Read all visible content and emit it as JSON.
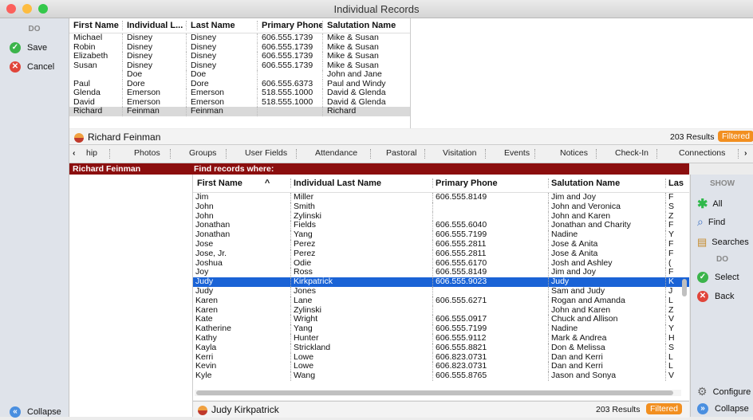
{
  "window": {
    "title": "Individual Records"
  },
  "left_sidebar": {
    "do_label": "DO",
    "save_label": "Save",
    "cancel_label": "Cancel",
    "collapse_label": "Collapse"
  },
  "top_table": {
    "columns": [
      "First Name",
      "Individual L...",
      "^",
      "Last Name",
      "Primary Phone",
      "Salutation Name"
    ],
    "rows": [
      [
        "Michael",
        "Disney",
        "Disney",
        "606.555.1739",
        "Mike & Susan"
      ],
      [
        "Robin",
        "Disney",
        "Disney",
        "606.555.1739",
        "Mike & Susan"
      ],
      [
        "Elizabeth",
        "Disney",
        "Disney",
        "606.555.1739",
        "Mike & Susan"
      ],
      [
        "Susan",
        "Disney",
        "Disney",
        "606.555.1739",
        "Mike & Susan"
      ],
      [
        "",
        "Doe",
        "Doe",
        "",
        "John and Jane"
      ],
      [
        "Paul",
        "Dore",
        "Dore",
        "606.555.6373",
        "Paul and Windy"
      ],
      [
        "Glenda",
        "Emerson",
        "Emerson",
        "518.555.1000",
        "David & Glenda"
      ],
      [
        "David",
        "Emerson",
        "Emerson",
        "518.555.1000",
        "David & Glenda"
      ],
      [
        "Richard",
        "Feinman",
        "Feinman",
        "",
        "Richard"
      ]
    ]
  },
  "name_bar": {
    "name": "Richard Feinman",
    "results": "203 Results",
    "filter_badge": "Filtered"
  },
  "tabs": [
    "hip",
    "Photos",
    "Groups",
    "User Fields",
    "Attendance",
    "Pastoral",
    "Visitation",
    "Events",
    "Notices",
    "Check-In",
    "Connections"
  ],
  "tab_nav": {
    "left": "‹",
    "right": "›"
  },
  "find_bar": {
    "record_name": "Richard Feinman",
    "find_label": "Find records where:"
  },
  "find_table": {
    "columns": [
      "First Name",
      "^",
      "Individual Last Name",
      "Primary Phone",
      "Salutation Name",
      "Las"
    ],
    "selected_index": 9,
    "rows": [
      [
        "Jim",
        "Miller",
        "606.555.8149",
        "Jim and Joy",
        "F"
      ],
      [
        "John",
        "Smith",
        "",
        "John and Veronica",
        "S"
      ],
      [
        "John",
        "Zylinski",
        "",
        "John and Karen",
        "Z"
      ],
      [
        "Jonathan",
        "Fields",
        "606.555.6040",
        "Jonathan and Charity",
        "F"
      ],
      [
        "Jonathan",
        "Yang",
        "606.555.7199",
        "Nadine",
        "Y"
      ],
      [
        "Jose",
        "Perez",
        "606.555.2811",
        "Jose & Anita",
        "F"
      ],
      [
        "Jose, Jr.",
        "Perez",
        "606.555.2811",
        "Jose & Anita",
        "F"
      ],
      [
        "Joshua",
        "Odie",
        "606.555.6170",
        "Josh and Ashley",
        "("
      ],
      [
        "Joy",
        "Ross",
        "606.555.8149",
        "Jim and Joy",
        "F"
      ],
      [
        "Judy",
        "Kirkpatrick",
        "606.555.9023",
        "Judy",
        "K"
      ],
      [
        "Judy",
        "Jones",
        "",
        "Sam and Judy",
        "J"
      ],
      [
        "Karen",
        "Lane",
        "606.555.6271",
        "Rogan and Amanda",
        "L"
      ],
      [
        "Karen",
        "Zylinski",
        "",
        "John and Karen",
        "Z"
      ],
      [
        "Kate",
        "Wright",
        "606.555.0917",
        "Chuck and Allison",
        "V"
      ],
      [
        "Katherine",
        "Yang",
        "606.555.7199",
        "Nadine",
        "Y"
      ],
      [
        "Kathy",
        "Hunter",
        "606.555.9112",
        "Mark & Andrea",
        "H"
      ],
      [
        "Kayla",
        "Strickland",
        "606.555.8821",
        "Don & Melissa",
        "S"
      ],
      [
        "Kerri",
        "Lowe",
        "606.823.0731",
        "Dan and Kerri",
        "L"
      ],
      [
        "Kevin",
        "Lowe",
        "606.823.0731",
        "Dan and Kerri",
        "L"
      ],
      [
        "Kyle",
        "Wang",
        "606.555.8765",
        "Jason and Sonya",
        "V"
      ]
    ]
  },
  "bottom_bar": {
    "name": "Judy Kirkpatrick",
    "results": "203 Results",
    "filter_badge": "Filtered"
  },
  "right_sidebar": {
    "show_label": "SHOW",
    "all_label": "All",
    "find_label": "Find",
    "searches_label": "Searches",
    "do_label": "DO",
    "select_label": "Select",
    "back_label": "Back",
    "configure_label": "Configure",
    "collapse_label": "Collapse"
  },
  "colors": {
    "accent": "#1a63d6",
    "header_red": "#8b0e0e",
    "badge_orange": "#f28f20",
    "save_green": "#3cb44b",
    "cancel_red": "#e0453a"
  }
}
